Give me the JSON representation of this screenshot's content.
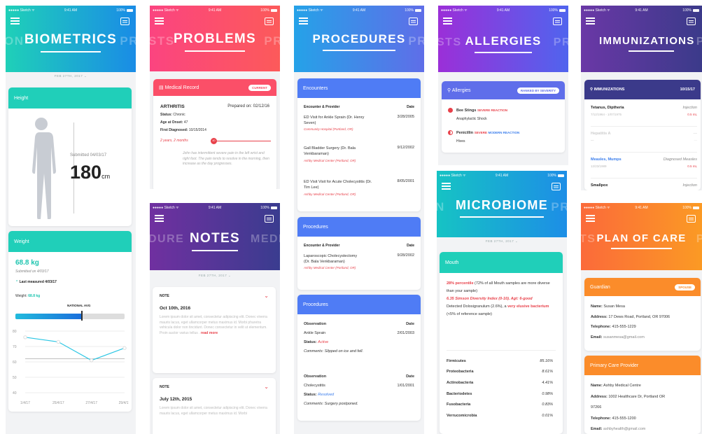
{
  "status": {
    "carrier": "●●●●● Sketch ᯤ",
    "time": "9:41 AM",
    "battery": "100%"
  },
  "biometrics": {
    "title": "BIOMETRICS",
    "ghost_left": "ON",
    "ghost_right": "PR",
    "date": "FEB 27TH, 2017",
    "height": {
      "label": "Height",
      "submitted": "Submitted 04/03/17",
      "value": "180",
      "unit": "cm"
    },
    "weight": {
      "label": "Weight",
      "value": "68.8 kg",
      "submitted": "Submitted on 4/03/17",
      "last": "Last measured 4/03/17",
      "weight_label": "Weight:",
      "weight_value": "68.8 kg",
      "national": "NATIONAL AVG",
      "chart_data": {
        "type": "line",
        "categories": [
          "1/4/17",
          "25/4/17",
          "27/4/17",
          "29/4/17"
        ],
        "values": [
          76,
          73,
          61,
          69
        ],
        "ylim": [
          40,
          80
        ],
        "ticks": [
          "80",
          "70",
          "60",
          "50",
          "40"
        ],
        "grid": true
      }
    }
  },
  "problems": {
    "title": "PROBLEMS",
    "ghost_left": "STS",
    "ghost_right": "PR",
    "record": {
      "header": "Medical Record",
      "badge": "CURRENT",
      "name": "ARTHRITIS",
      "prepared": "Prepared on: 02/12/16",
      "status_label": "Status:",
      "status_value": "Chronic",
      "age_label": "Age at Onset:",
      "age_value": "47",
      "diag_label": "First Diagnosed:",
      "diag_value": "10/15/2014",
      "duration": "2 years, 2 months",
      "knob": "40",
      "desc": "John has intermittent severe pain in the left wrist and right foot. The pain tends to resolve in the morning, then increase as the day progresses."
    }
  },
  "notes": {
    "title": "NOTES",
    "ghost_left": "DURE",
    "ghost_right": "MEDI",
    "date": "FEB 27TH, 2017",
    "items": [
      {
        "label": "NOTE",
        "date": "Oct 10th, 2016",
        "body": "Lorem ipsum dolor sit amet, consectetur adipiscing elit. Donec viverra mauris lacus, eget ullamcorper metus maximus id. Morbi pharetra vehicula dolor non tincidunt. Donec consectetur in velit ut elementum. Proin auctor varius tellus .",
        "more": "read more"
      },
      {
        "label": "NOTE",
        "date": "July 12th, 2015",
        "body": "Lorem ipsum dolor sit amet, consectetur adipiscing elit. Donec viverra mauris lacus, eget ullamcorper metus maximus id. Morbi"
      }
    ]
  },
  "procedures": {
    "title": "PROCEDURES",
    "ghost_right": "PR",
    "encounters": {
      "header": "Encounters",
      "col1": "Encounter & Provider",
      "col2": "Date",
      "rows": [
        {
          "name": "ED Visit for Ankle Sprain (Dr. Henry Seven)",
          "place": "Community Hospital (Portland, OR)",
          "date": "3/28/2005"
        },
        {
          "name": "Gall Bladder Surgery (Dr. Bala Venkbaraman)",
          "place": "Ashby Medical Center (Portland, OR)",
          "date": "9/12/2002"
        },
        {
          "name": "ED Visit Visit for Acute Cholecystitis (Dr. Tim Lee)",
          "place": "Ashby Medical Center (Portland, OR)",
          "date": "8/05/2001"
        }
      ]
    },
    "procs1": {
      "header": "Procedures",
      "col1": "Encounter & Provider",
      "col2": "Date",
      "name": "Laparoscopic Cholecystectomy (Dr. Bala Venkbaraman)",
      "place": "Ashby Medical Center (Portland, OR)",
      "date": "9/28/2002"
    },
    "procs2": {
      "header": "Procedures",
      "rows": [
        {
          "col1": "Observation",
          "col2": "Date",
          "obs": "Ankle Sprain",
          "date": "2/01/2003",
          "status_label": "Status:",
          "status": "Active",
          "comments": "Comments: Slipped on ice and fell."
        },
        {
          "col1": "Observation",
          "col2": "Date",
          "obs": "Cholecystitis",
          "date": "1/01/2001",
          "status_label": "Status:",
          "status": "Resolved",
          "comments": "Comments: Surgery postponed."
        }
      ]
    }
  },
  "allergies": {
    "title": "ALLERGIES",
    "ghost_left": "STS",
    "ghost_right": "PR",
    "header": "Allergies",
    "badge": "RANKED BY SEVERITY",
    "items": [
      {
        "name": "Bee Stings",
        "severity": "SEVERE REACTION",
        "sub": "Anaphylactic Shock"
      },
      {
        "name": "Penicillin",
        "severity": "SEVERE",
        "severity2": "MODERN REACTION",
        "sub": "Hives"
      }
    ]
  },
  "microbiome": {
    "title": "MICROBIOME",
    "ghost_left": "N",
    "ghost_right": "PR",
    "date": "FEB 27TH, 2017",
    "mouth": {
      "header": "Mouth",
      "p1a": "28% percentile",
      "p1b": " (72% of all Mouth samples are more diverse than your sample)",
      "p2": "6.35 Simson Diversity Index (0-10). Agt: 6-good",
      "p3a": "Detected Dolosigranulum (2.6%), a ",
      "p3b": "very elusive bacterium",
      "p3c": " (<5% of reference sample)"
    },
    "taxa": [
      {
        "name": "Firmicutes",
        "pct": "85.16%"
      },
      {
        "name": "Proteobacteria",
        "pct": "8.61%"
      },
      {
        "name": "Actinobacteria",
        "pct": "4.41%"
      },
      {
        "name": "Bacteriodetes",
        "pct": "0.98%"
      },
      {
        "name": "Fusobacteria",
        "pct": "0.83%"
      },
      {
        "name": "Verrucomicrobia",
        "pct": "0.01%"
      }
    ]
  },
  "immunizations": {
    "title": "IMMUNIZATIONS",
    "ghost_right": "P",
    "header": "IMMUNIZATIONS",
    "date": "10/15/17",
    "items": [
      {
        "name": "Tetanus, Diptheria",
        "type": "Injection",
        "dates": "7/12/1964 - 1/07/1975",
        "dose": "0.5 mL"
      },
      {
        "name": "Hepatitis A",
        "type": "—",
        "dates": "—",
        "dose": "—"
      },
      {
        "name": "Measles, Mumps",
        "type": "Diagnosed Measles",
        "dates": "12/23/1989",
        "dose": "0.5 mL"
      },
      {
        "name": "Smallpox",
        "type": "Injection"
      }
    ]
  },
  "plan": {
    "title": "PLAN OF CARE",
    "ghost_left": "TS",
    "ghost_right": "P",
    "guardian": {
      "header": "Guardian",
      "badge": "SPOUSE",
      "name_label": "Name:",
      "name": "Susan Mesa",
      "addr_label": "Address:",
      "addr": "17 Dews Road, Portland, OR 97006",
      "tel_label": "Telephone:",
      "tel": "415-555-1229",
      "email_label": "Email:",
      "email": "susanmesa@gmail.com"
    },
    "provider": {
      "header": "Primary Care Provider",
      "name_label": "Name:",
      "name": "Ashby Medical Centre",
      "addr_label": "Address:",
      "addr": "1002 Healthcare Dr, Portland OR",
      "addr2": "97266",
      "tel_label": "Telephone:",
      "tel": "415-555-1200",
      "email_label": "Email:",
      "email": "ashbyhealth@gmail.com"
    }
  },
  "colors": {
    "teal": "#1fd0b8",
    "blue": "#1a8ce6",
    "pink": "#fb4480",
    "red": "#fc5a5a",
    "purple": "#6f3aa8",
    "proc": "#4f7cf5",
    "orange": "#fb8c2a",
    "indigo": "#3b3a8a"
  }
}
